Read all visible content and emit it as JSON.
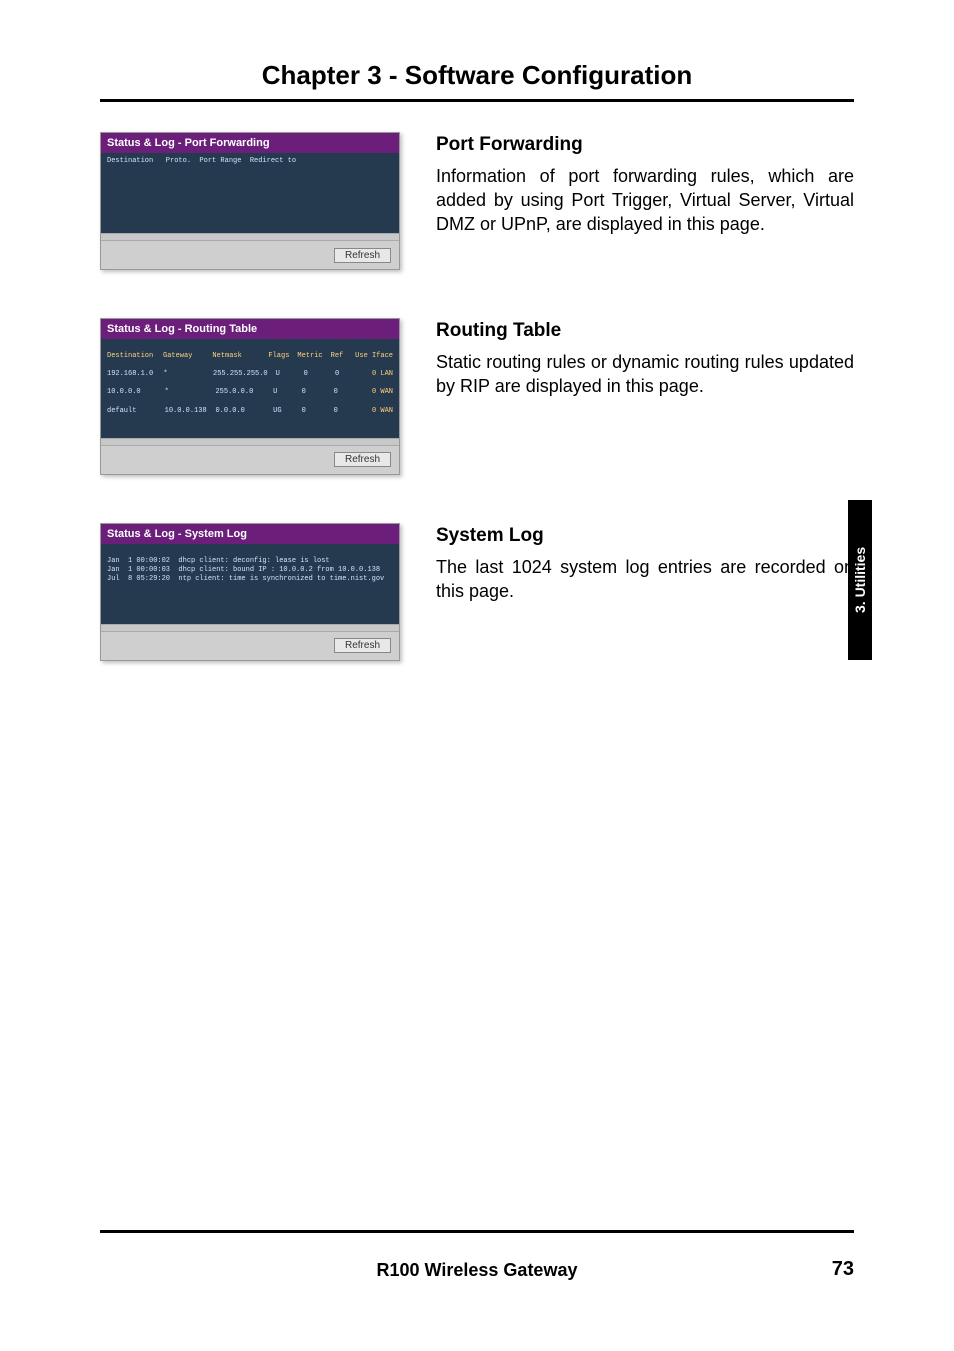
{
  "chapter_title": "Chapter 3 - Software Configuration",
  "side_tab": "3. Utilities",
  "footer_title": "R100 Wireless Gateway",
  "page_number": "73",
  "refresh_label": "Refresh",
  "sections": {
    "port_forwarding": {
      "shot_title": "Status & Log - Port Forwarding",
      "body_cols": "Destination   Proto.  Port Range  Redirect to",
      "heading": "Port Forwarding",
      "text": "Information of port forwarding rules, which are added by using Port Trigger, Virtual Server, Virtual DMZ or UPnP, are displayed in this page."
    },
    "routing_table": {
      "shot_title": "Status & Log - Routing Table",
      "header_row": [
        "Destination",
        "Gateway",
        "Netmask",
        "Flags",
        "Metric",
        "Ref",
        "Use Iface"
      ],
      "rows": [
        [
          "192.168.1.0",
          "*",
          "255.255.255.0",
          "U",
          "0",
          "0",
          "0 LAN"
        ],
        [
          "10.0.0.0",
          "*",
          "255.0.0.0",
          "U",
          "0",
          "0",
          "0 WAN"
        ],
        [
          "default",
          "10.0.0.138",
          "0.0.0.0",
          "UG",
          "0",
          "0",
          "0 WAN"
        ]
      ],
      "heading": "Routing Table",
      "text": "Static routing rules or dynamic routing rules updated by RIP are displayed in this page."
    },
    "system_log": {
      "shot_title": "Status & Log - System Log",
      "lines": [
        "Jan  1 00:00:02  dhcp client: deconfig: lease is lost",
        "Jan  1 00:00:03  dhcp client: bound IP : 10.0.0.2 from 10.0.0.138",
        "Jul  8 05:29:20  ntp client: time is synchronized to time.nist.gov"
      ],
      "heading": "System Log",
      "text": "The last 1024 system log entries are recorded on this page."
    }
  }
}
